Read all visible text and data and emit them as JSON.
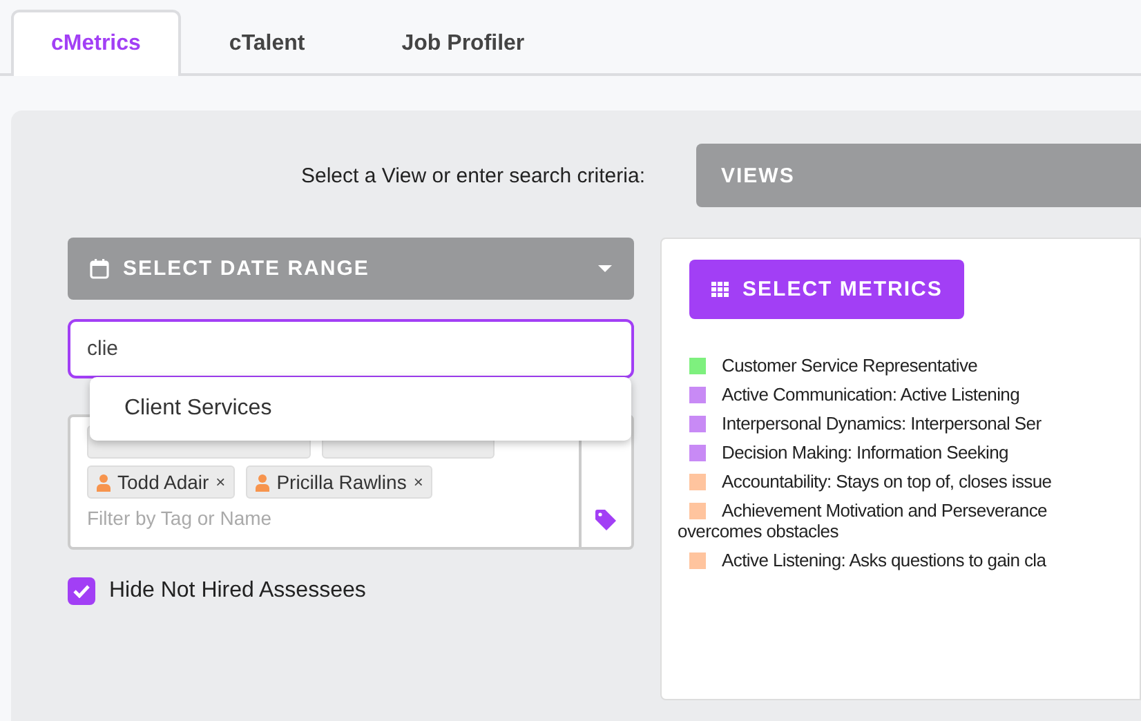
{
  "tabs": [
    {
      "label": "cMetrics",
      "selected": true
    },
    {
      "label": "cTalent",
      "selected": false
    },
    {
      "label": "Job Profiler",
      "selected": false
    }
  ],
  "prompt": "Select a View or enter search criteria:",
  "views_button": "VIEWS",
  "date_range_button": "SELECT DATE RANGE",
  "search": {
    "value": "clie",
    "suggestions": [
      "Client Services"
    ]
  },
  "tag_filter": {
    "tags": [
      {
        "covered": true
      },
      {
        "covered": true
      },
      {
        "name": "Todd Adair"
      },
      {
        "name": "Pricilla Rawlins"
      }
    ],
    "placeholder": "Filter by Tag or Name",
    "remove_symbol": "×"
  },
  "hide_not_hired": {
    "label": "Hide Not Hired Assessees",
    "checked": true
  },
  "metrics_button": "SELECT METRICS",
  "metrics": [
    {
      "lines": [
        "Customer Service Representative"
      ],
      "color": "#7ef07e"
    },
    {
      "lines": [
        "Active Communication: Active Listening"
      ],
      "color": "#c88af5"
    },
    {
      "lines": [
        "Interpersonal Dynamics: Interpersonal Ser"
      ],
      "color": "#c88af5"
    },
    {
      "lines": [
        "Decision Making: Information Seeking"
      ],
      "color": "#c88af5"
    },
    {
      "lines": [
        "Accountability: Stays on top of, closes issue"
      ],
      "color": "#ffc49e"
    },
    {
      "lines": [
        "Achievement Motivation and Perseverance",
        "overcomes obstacles"
      ],
      "color": "#ffc49e"
    },
    {
      "lines": [
        "Active Listening: Asks questions to gain cla"
      ],
      "color": "#ffc49e"
    }
  ]
}
